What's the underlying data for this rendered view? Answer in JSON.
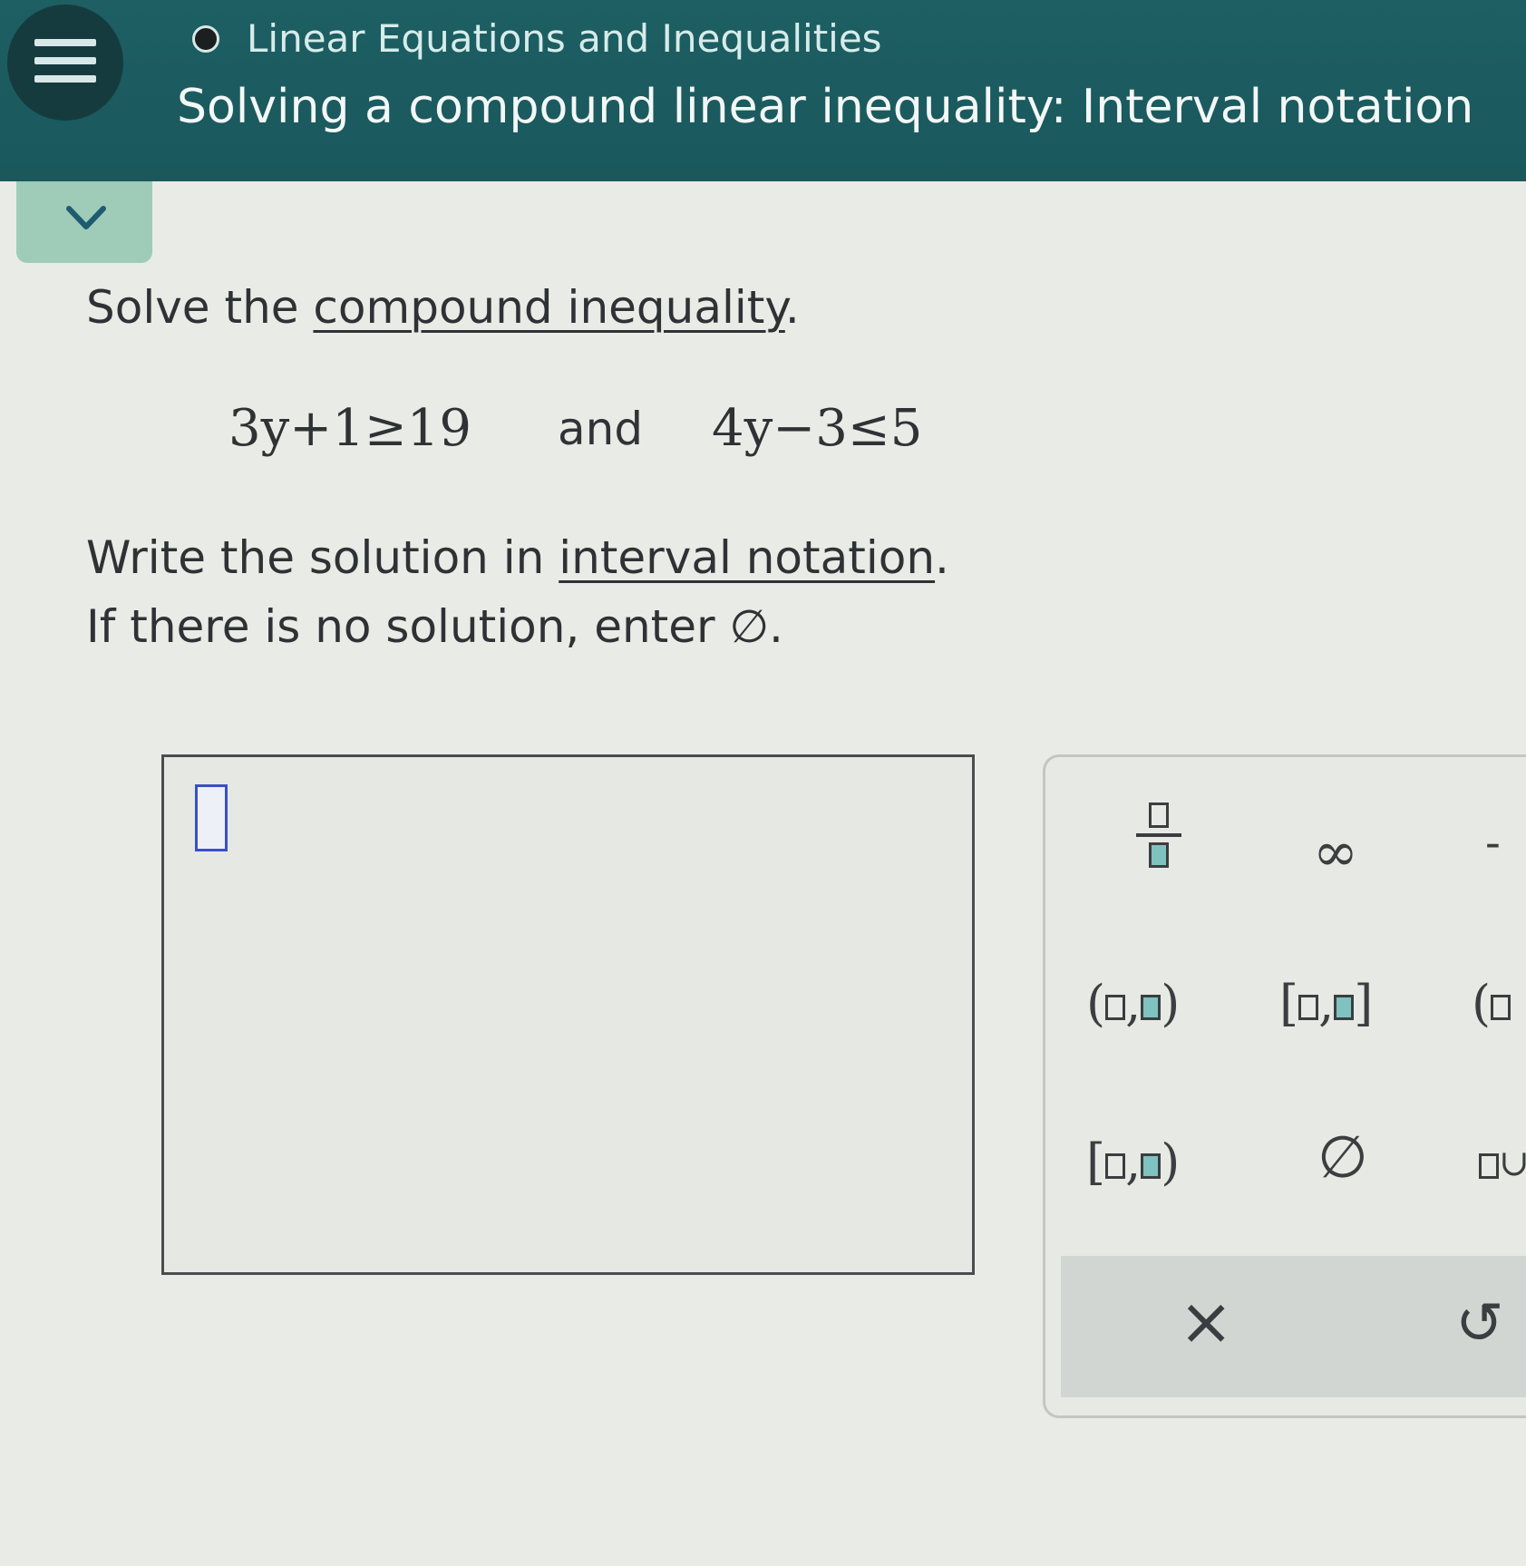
{
  "header": {
    "topic": "Linear Equations and Inequalities",
    "title": "Solving a compound linear inequality: Interval notation"
  },
  "problem": {
    "line1_prefix": "Solve the ",
    "line1_link": "compound inequality",
    "line1_suffix": ".",
    "eq1": "3y+1≥19",
    "and_word": "and",
    "eq2": "4y−3≤5",
    "line2_prefix": "Write the solution in ",
    "line2_link": "interval notation",
    "line2_suffix": ".",
    "line3": "If there is no solution, enter ∅."
  },
  "keypad": {
    "infinity": "∞",
    "empty_set": "∅",
    "clear": "×",
    "undo": "↺"
  },
  "colors": {
    "header": "#1d5f63",
    "accent": "#9fccb8",
    "cursor": "#3a4fc7"
  }
}
